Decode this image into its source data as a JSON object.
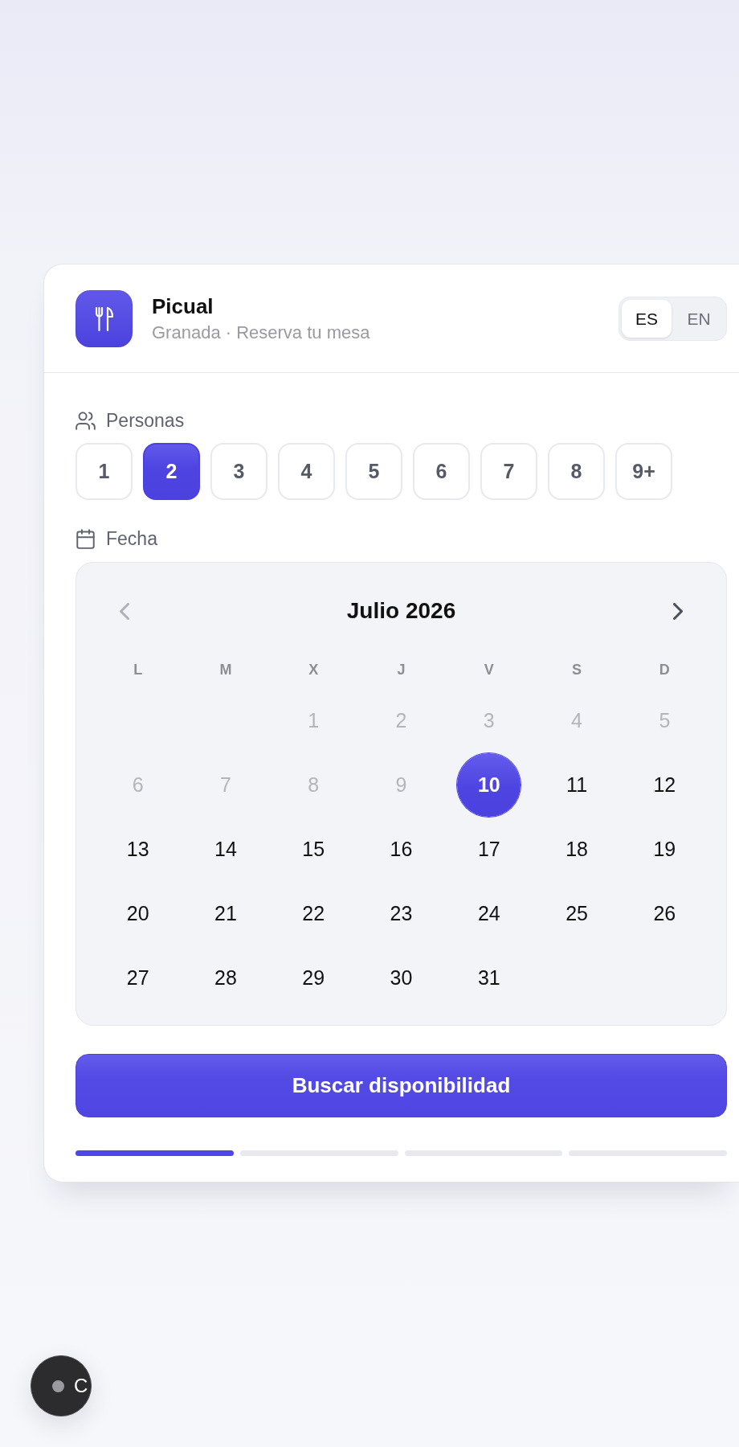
{
  "header": {
    "title": "Picual",
    "subtitle": "Granada · Reserva tu mesa",
    "languages": [
      {
        "label": "ES",
        "selected": true
      },
      {
        "label": "EN",
        "selected": false
      }
    ]
  },
  "party_size": {
    "label": "Personas",
    "options": [
      {
        "label": "1",
        "selected": false
      },
      {
        "label": "2",
        "selected": true
      },
      {
        "label": "3",
        "selected": false
      },
      {
        "label": "4",
        "selected": false
      },
      {
        "label": "5",
        "selected": false
      },
      {
        "label": "6",
        "selected": false
      },
      {
        "label": "7",
        "selected": false
      },
      {
        "label": "8",
        "selected": false
      },
      {
        "label": "9+",
        "selected": false
      }
    ]
  },
  "date": {
    "label": "Fecha",
    "calendar": {
      "month": "Julio 2026",
      "nav": [
        {
          "kind": "prev",
          "disabled": true
        },
        {
          "kind": "next",
          "disabled": false
        }
      ],
      "weekdays": [
        "L",
        "M",
        "X",
        "J",
        "V",
        "S",
        "D"
      ],
      "weeks": [
        [
          {
            "kind": "empty"
          },
          {
            "kind": "empty"
          },
          {
            "kind": "day",
            "label": "1",
            "disabled": true,
            "selected": false
          },
          {
            "kind": "day",
            "label": "2",
            "disabled": true,
            "selected": false
          },
          {
            "kind": "day",
            "label": "3",
            "disabled": true,
            "selected": false
          },
          {
            "kind": "day",
            "label": "4",
            "disabled": true,
            "selected": false
          },
          {
            "kind": "day",
            "label": "5",
            "disabled": true,
            "selected": false
          }
        ],
        [
          {
            "kind": "day",
            "label": "6",
            "disabled": true,
            "selected": false
          },
          {
            "kind": "day",
            "label": "7",
            "disabled": true,
            "selected": false
          },
          {
            "kind": "day",
            "label": "8",
            "disabled": true,
            "selected": false
          },
          {
            "kind": "day",
            "label": "9",
            "disabled": true,
            "selected": false
          },
          {
            "kind": "day",
            "label": "10",
            "disabled": false,
            "selected": true
          },
          {
            "kind": "day",
            "label": "11",
            "disabled": false,
            "selected": false
          },
          {
            "kind": "day",
            "label": "12",
            "disabled": false,
            "selected": false
          }
        ],
        [
          {
            "kind": "day",
            "label": "13",
            "disabled": false,
            "selected": false
          },
          {
            "kind": "day",
            "label": "14",
            "disabled": false,
            "selected": false
          },
          {
            "kind": "day",
            "label": "15",
            "disabled": false,
            "selected": false
          },
          {
            "kind": "day",
            "label": "16",
            "disabled": false,
            "selected": false
          },
          {
            "kind": "day",
            "label": "17",
            "disabled": false,
            "selected": false
          },
          {
            "kind": "day",
            "label": "18",
            "disabled": false,
            "selected": false
          },
          {
            "kind": "day",
            "label": "19",
            "disabled": false,
            "selected": false
          }
        ],
        [
          {
            "kind": "day",
            "label": "20",
            "disabled": false,
            "selected": false
          },
          {
            "kind": "day",
            "label": "21",
            "disabled": false,
            "selected": false
          },
          {
            "kind": "day",
            "label": "22",
            "disabled": false,
            "selected": false
          },
          {
            "kind": "day",
            "label": "23",
            "disabled": false,
            "selected": false
          },
          {
            "kind": "day",
            "label": "24",
            "disabled": false,
            "selected": false
          },
          {
            "kind": "day",
            "label": "25",
            "disabled": false,
            "selected": false
          },
          {
            "kind": "day",
            "label": "26",
            "disabled": false,
            "selected": false
          }
        ],
        [
          {
            "kind": "day",
            "label": "27",
            "disabled": false,
            "selected": false
          },
          {
            "kind": "day",
            "label": "28",
            "disabled": false,
            "selected": false
          },
          {
            "kind": "day",
            "label": "29",
            "disabled": false,
            "selected": false
          },
          {
            "kind": "day",
            "label": "30",
            "disabled": false,
            "selected": false
          },
          {
            "kind": "day",
            "label": "31",
            "disabled": false,
            "selected": false
          }
        ]
      ]
    }
  },
  "search_button": {
    "label": "Buscar disponibilidad"
  },
  "steps": [
    {
      "active": true
    },
    {
      "active": false
    },
    {
      "active": false
    },
    {
      "active": false
    }
  ],
  "floating_button": {
    "label": "C"
  }
}
